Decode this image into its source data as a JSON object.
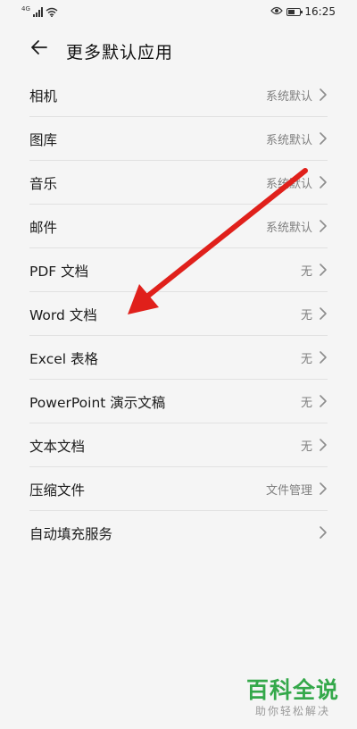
{
  "status_bar": {
    "network": "4G",
    "time": "16:25",
    "battery_level": 0.55,
    "icons": [
      "signal-icon",
      "wifi-icon",
      "eye-icon",
      "battery-icon"
    ]
  },
  "header": {
    "title": "更多默认应用",
    "back_icon": "back-arrow-icon"
  },
  "items": [
    {
      "label": "相机",
      "value": "系统默认"
    },
    {
      "label": "图库",
      "value": "系统默认"
    },
    {
      "label": "音乐",
      "value": "系统默认"
    },
    {
      "label": "邮件",
      "value": "系统默认"
    },
    {
      "label": "PDF 文档",
      "value": "无"
    },
    {
      "label": "Word 文档",
      "value": "无"
    },
    {
      "label": "Excel 表格",
      "value": "无"
    },
    {
      "label": "PowerPoint 演示文稿",
      "value": "无"
    },
    {
      "label": "文本文档",
      "value": "无"
    },
    {
      "label": "压缩文件",
      "value": "文件管理"
    },
    {
      "label": "自动填充服务",
      "value": ""
    }
  ],
  "annotation": {
    "color": "#e0201b",
    "icon": "red-arrow-annotation"
  },
  "watermark": {
    "title": "百科全说",
    "subtitle": "助你轻松解决",
    "color": "#34a84a"
  }
}
